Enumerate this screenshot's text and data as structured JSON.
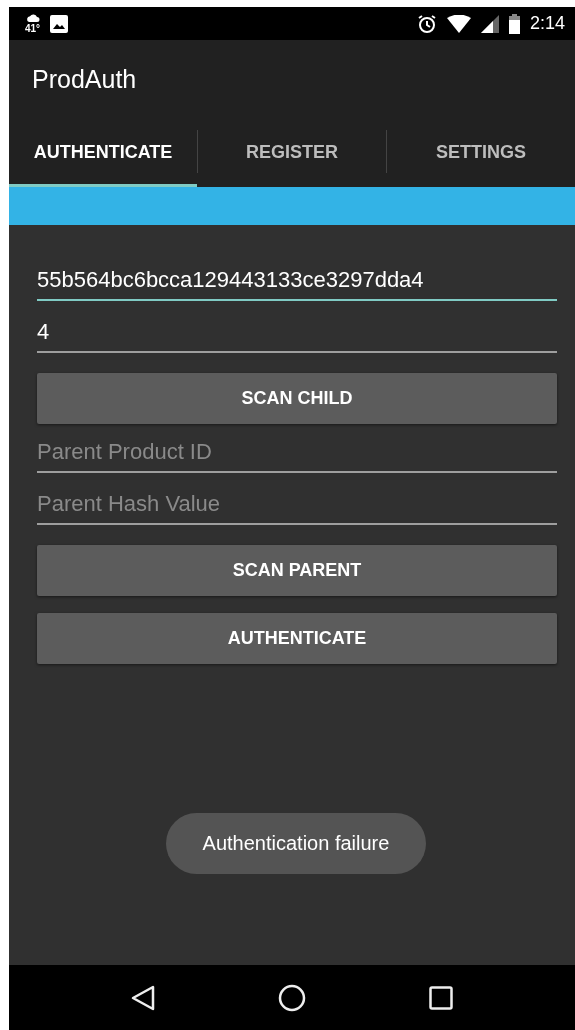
{
  "status_bar": {
    "temperature": "41°",
    "time": "2:14"
  },
  "app_bar": {
    "title": "ProdAuth"
  },
  "tabs": [
    {
      "label": "AUTHENTICATE",
      "selected": true
    },
    {
      "label": "REGISTER",
      "selected": false
    },
    {
      "label": "SETTINGS",
      "selected": false
    }
  ],
  "form": [
    {
      "kind": "field",
      "value": "55b564bc6bcca129443133ce3297dda4",
      "focused": true
    },
    {
      "kind": "field",
      "value": "4",
      "focused": false
    },
    {
      "kind": "button",
      "label": "SCAN CHILD"
    },
    {
      "kind": "field",
      "placeholder": "Parent Product ID",
      "focused": false
    },
    {
      "kind": "field",
      "placeholder": "Parent Hash Value",
      "focused": false
    },
    {
      "kind": "button",
      "label": "SCAN PARENT"
    },
    {
      "kind": "button",
      "label": "AUTHENTICATE"
    }
  ],
  "toast": {
    "message": "Authentication failure"
  }
}
